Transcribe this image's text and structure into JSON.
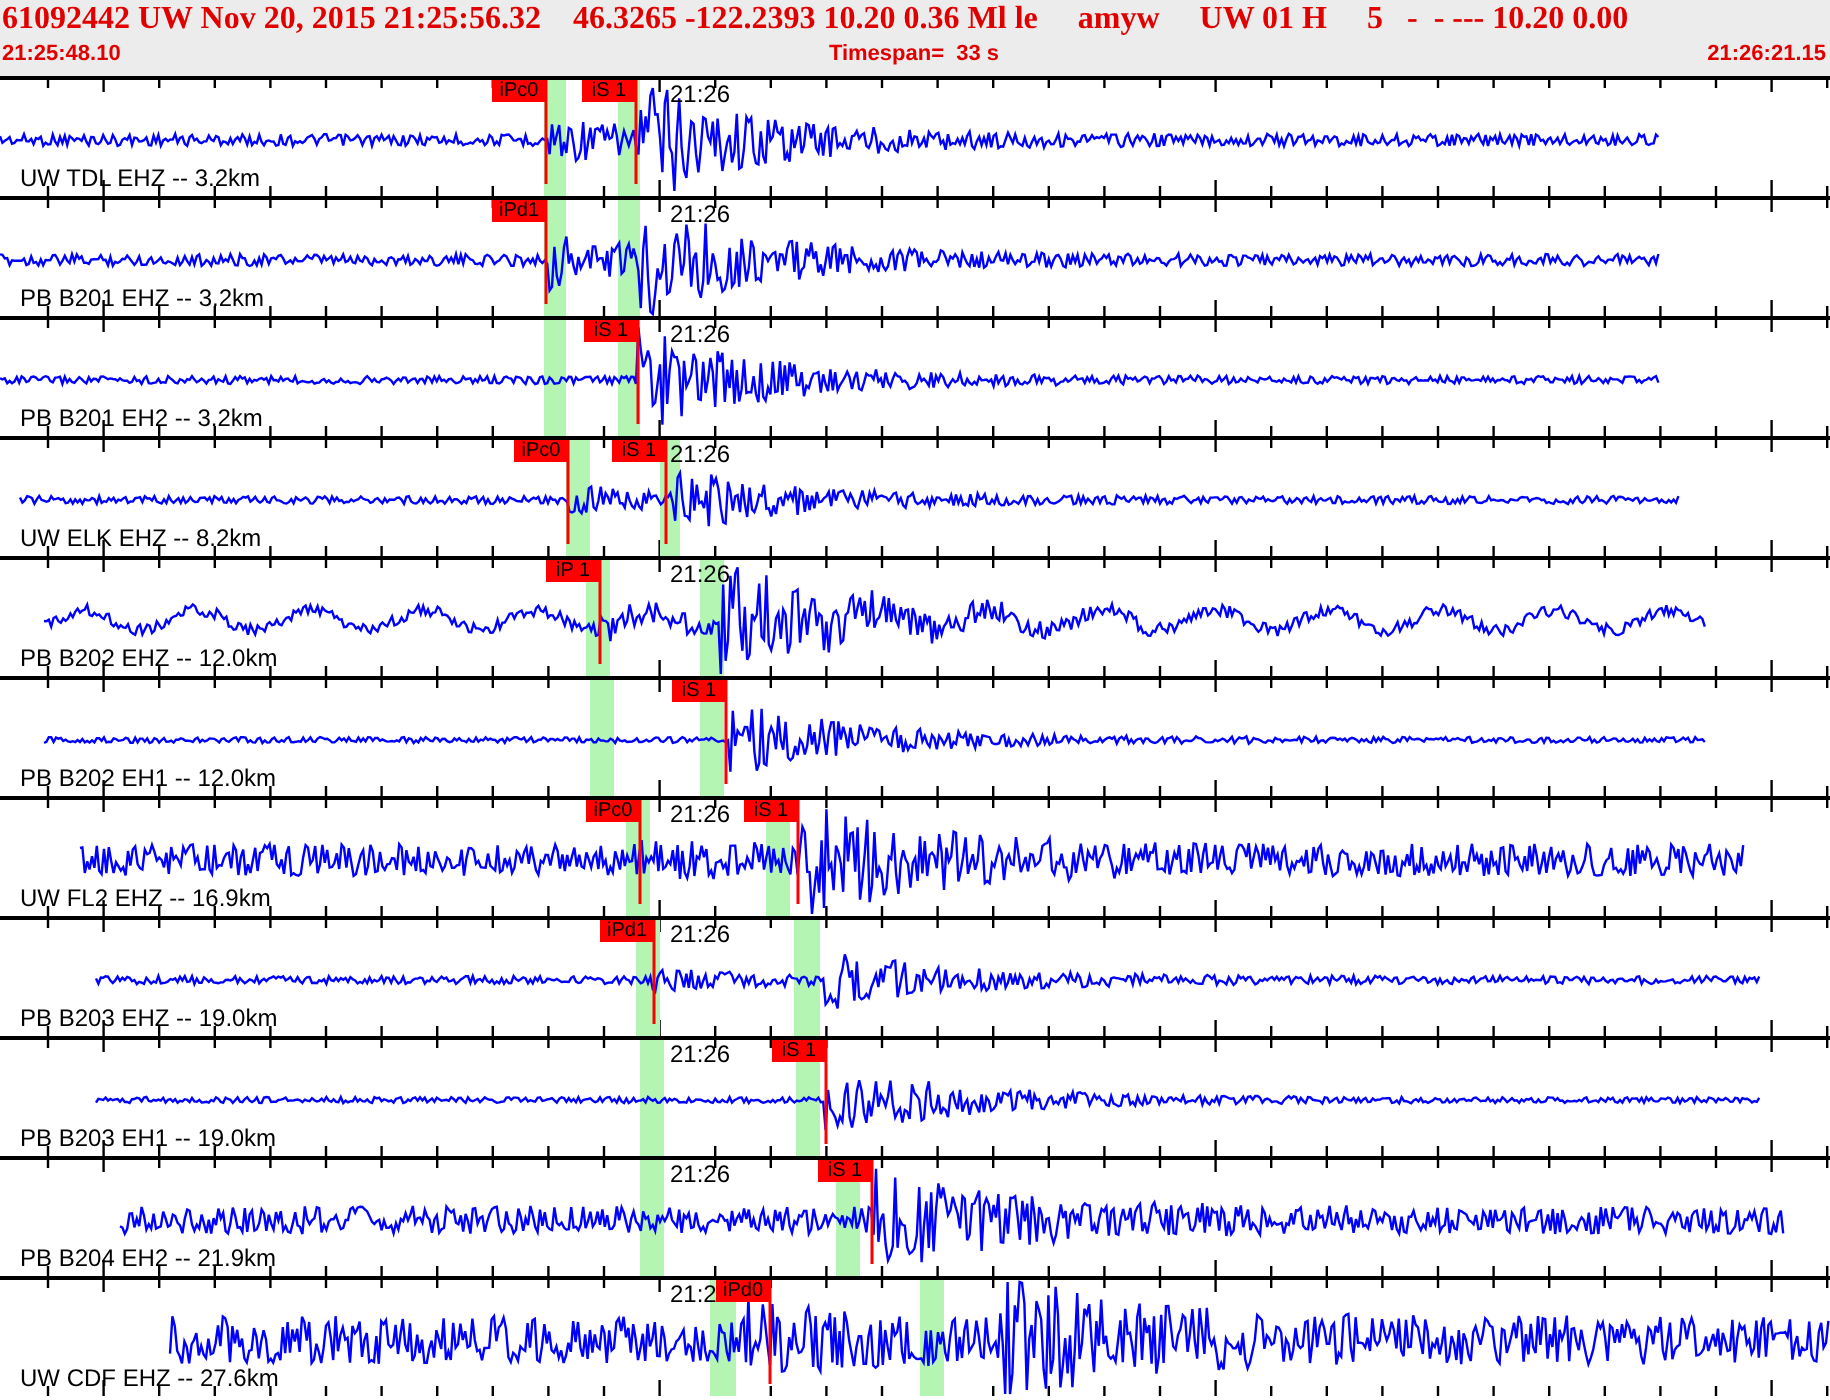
{
  "header": {
    "event_line": "61092442 UW Nov 20, 2015 21:25:56.32    46.3265 -122.2393 10.20 0.36 Ml le     amyw     UW 01 H     5   -  - --- 10.20 0.00",
    "start_time": "21:25:48.10",
    "timespan": "Timespan=  33 s",
    "end_time": "21:26:21.15"
  },
  "traces": [
    {
      "label": "UW TDL EHZ -- 3.2km",
      "time_mark": "21:26",
      "picks": [
        {
          "label": "iPc0"
        },
        {
          "label": "iS 1"
        }
      ]
    },
    {
      "label": "PB B201 EHZ -- 3.2km",
      "time_mark": "21:26",
      "picks": [
        {
          "label": "iPd1"
        }
      ]
    },
    {
      "label": "PB B201 EH2 -- 3.2km",
      "time_mark": "21:26",
      "picks": [
        {
          "label": "iS 1"
        }
      ]
    },
    {
      "label": "UW ELK EHZ -- 8.2km",
      "time_mark": "21:26",
      "picks": [
        {
          "label": "iPc0"
        },
        {
          "label": "iS 1"
        }
      ]
    },
    {
      "label": "PB B202 EHZ -- 12.0km",
      "time_mark": "21:26",
      "picks": [
        {
          "label": "iP 1"
        }
      ]
    },
    {
      "label": "PB B202 EH1 -- 12.0km",
      "picks": [
        {
          "label": "iS 1"
        }
      ]
    },
    {
      "label": "UW FL2 EHZ -- 16.9km",
      "time_mark": "21:26",
      "picks": [
        {
          "label": "iPc0"
        },
        {
          "label": "iS 1"
        }
      ]
    },
    {
      "label": "PB B203 EHZ -- 19.0km",
      "time_mark": "21:26",
      "picks": [
        {
          "label": "iPd1"
        }
      ]
    },
    {
      "label": "PB B203 EH1 -- 19.0km",
      "time_mark": "21:26",
      "picks": [
        {
          "label": "iS 1"
        }
      ]
    },
    {
      "label": "PB B204 EH2 -- 21.9km",
      "time_mark": "21:26",
      "picks": [
        {
          "label": "iS 1"
        }
      ]
    },
    {
      "label": "UW CDF EHZ -- 27.6km",
      "time_mark": "21:2",
      "picks": [
        {
          "label": "iPd0"
        }
      ]
    }
  ]
}
